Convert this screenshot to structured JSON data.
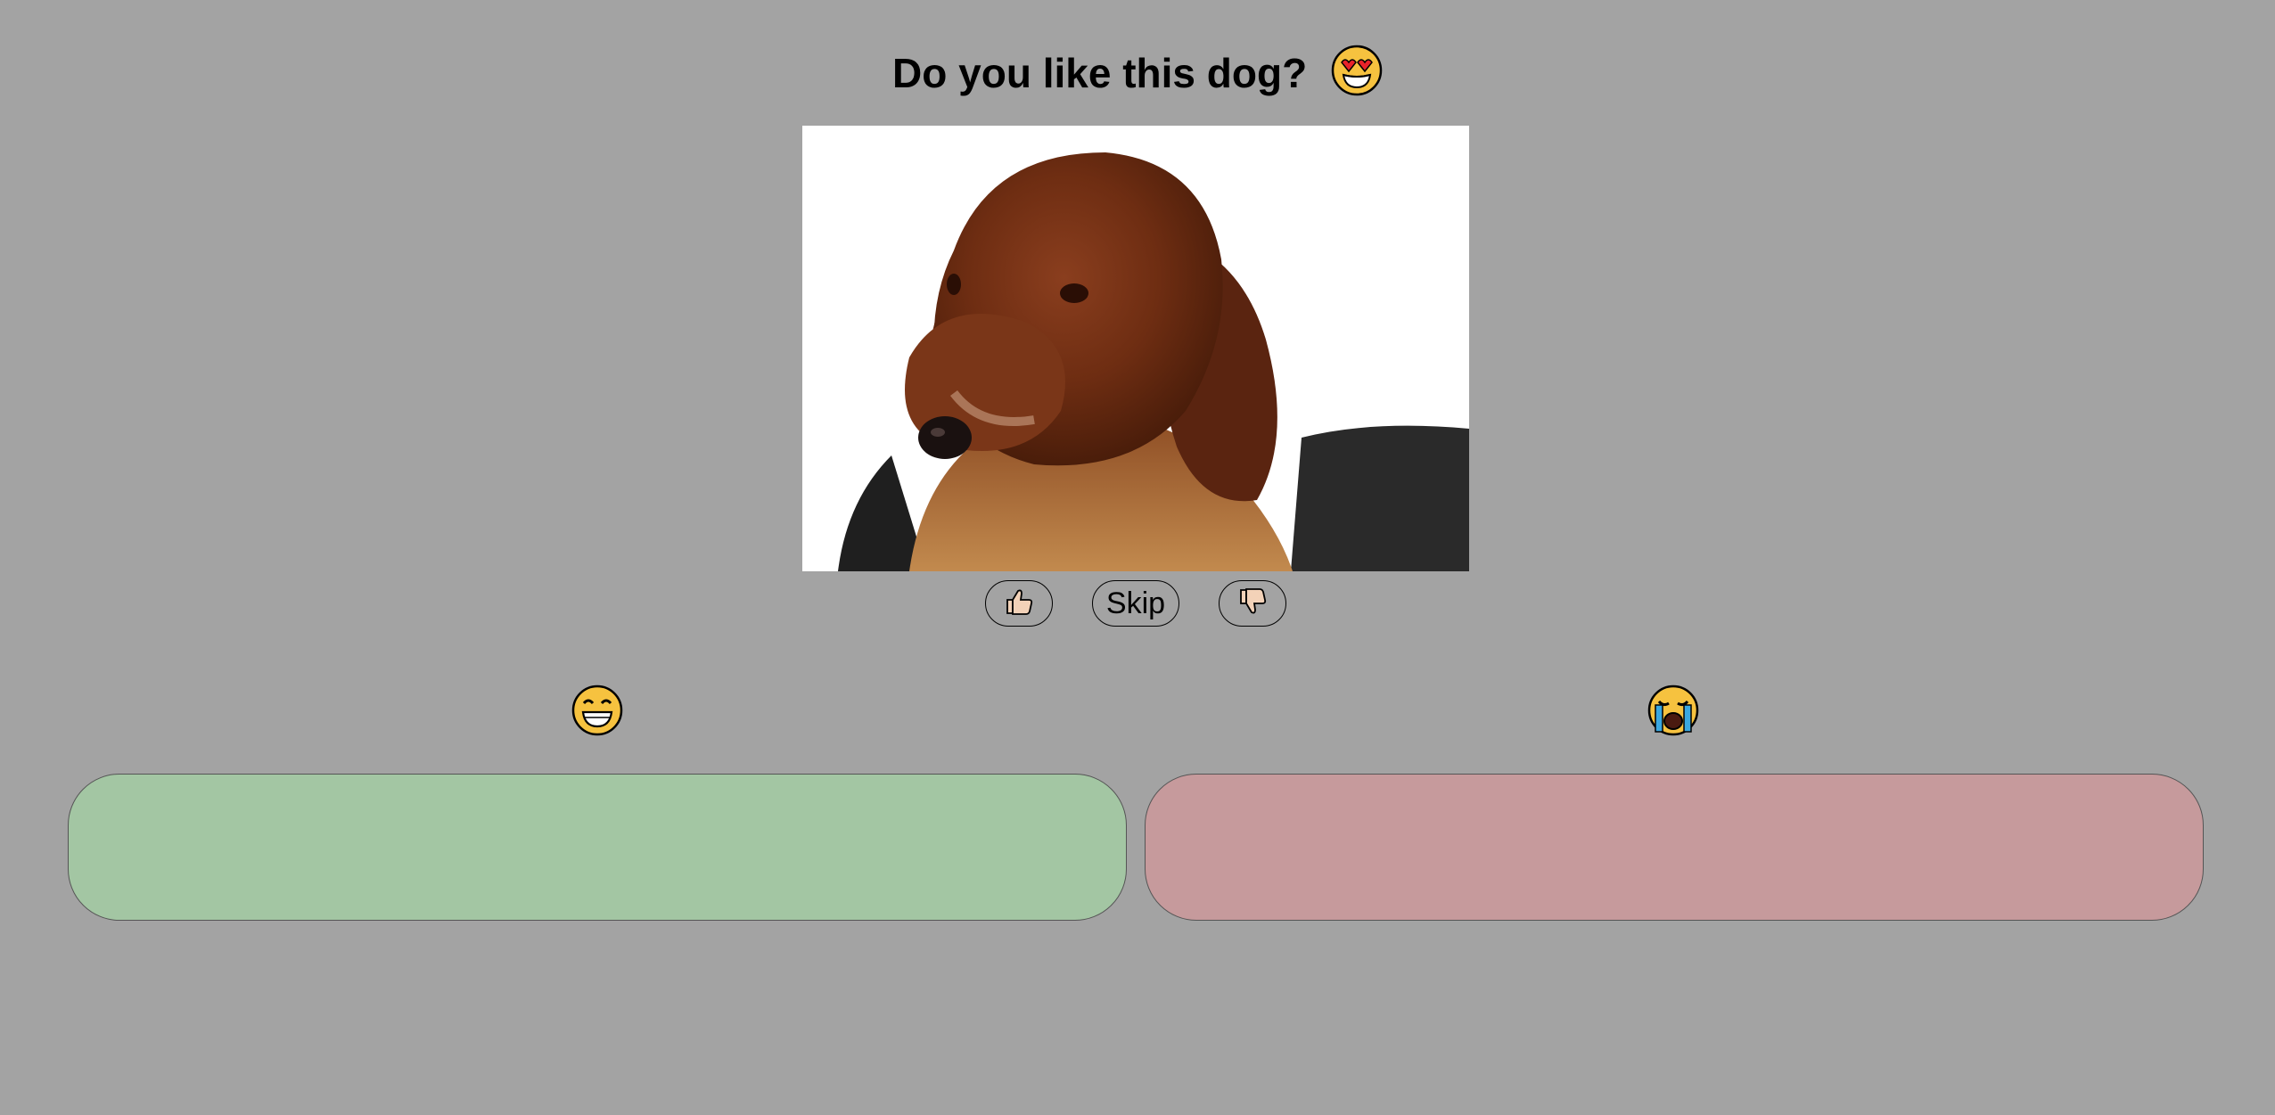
{
  "header": {
    "title": "Do you like this dog?",
    "title_icon": "heart-eyes-face-icon"
  },
  "image": {
    "subject": "dog-photo",
    "alt": "dog"
  },
  "controls": {
    "like_icon": "thumbs-up-icon",
    "skip_label": "Skip",
    "dislike_icon": "thumbs-down-icon"
  },
  "buckets": {
    "liked": {
      "icon": "grinning-face-icon",
      "color": "#a3c6a3"
    },
    "disliked": {
      "icon": "crying-face-icon",
      "color": "#c69a9c"
    }
  },
  "colors": {
    "background": "#a3a3a3"
  }
}
